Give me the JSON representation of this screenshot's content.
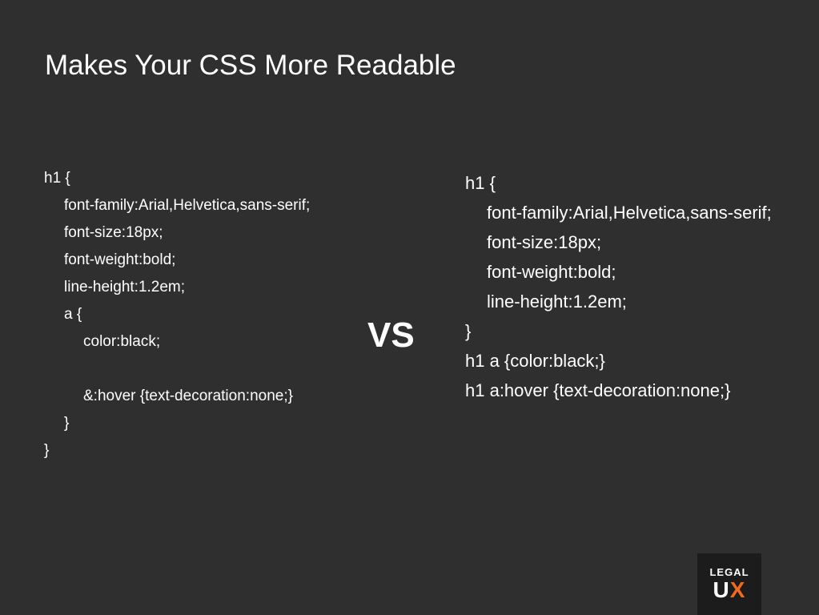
{
  "slide": {
    "title": "Makes Your CSS More Readable",
    "vs_label": "VS"
  },
  "left_code": {
    "lines": [
      "h1 {",
      "font-family:Arial,Helvetica,sans-serif;",
      "font-size:18px;",
      "font-weight:bold;",
      "line-height:1.2em;",
      "a {",
      "color:black;",
      "",
      "&:hover {text-decoration:none;}",
      "}",
      "}"
    ]
  },
  "right_code": {
    "lines": [
      "h1 {",
      "font-family:Arial,Helvetica,sans-serif;",
      "font-size:18px;",
      "font-weight:bold;",
      "line-height:1.2em;",
      "}",
      "h1 a {color:black;}",
      "h1 a:hover {text-decoration:none;}"
    ]
  },
  "logo": {
    "top_word": "LEGAL",
    "u": "U",
    "x": "X",
    "accent_color": "#f26b1d"
  },
  "colors": {
    "background": "#2f2f2f",
    "text": "#ffffff",
    "logo_background": "#1c1c1c"
  }
}
